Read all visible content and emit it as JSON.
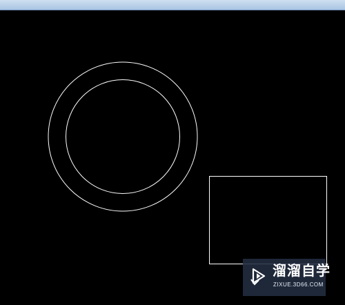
{
  "canvas": {
    "background": "#000000",
    "stroke": "#ffffff",
    "shapes": [
      "outer-circle",
      "inner-circle",
      "rectangle"
    ]
  },
  "watermark": {
    "brand": "溜溜自学",
    "url": "ZIXUE.3D66.COM",
    "icon": "play-logo-icon",
    "background": "#232d41"
  }
}
